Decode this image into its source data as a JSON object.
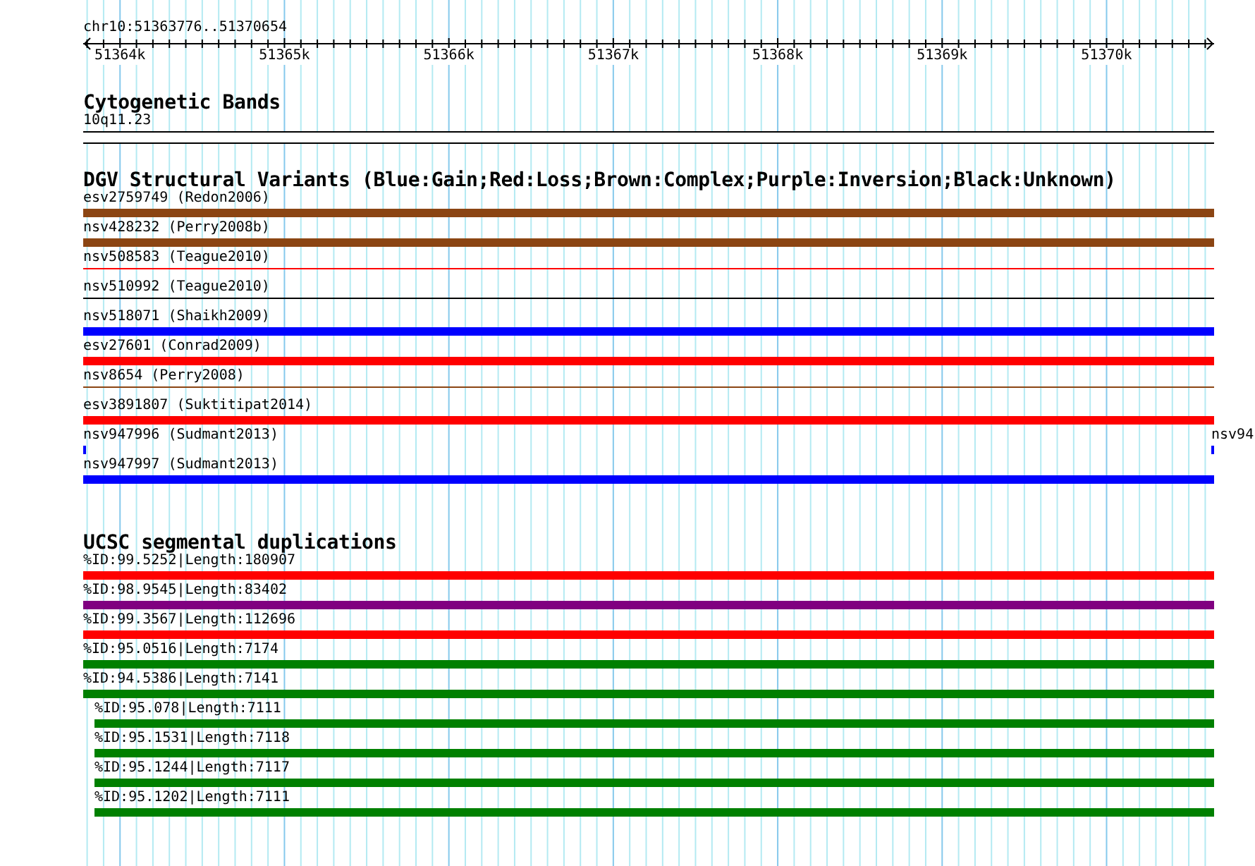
{
  "ruler": {
    "range": "chr10:51363776..51370654",
    "ticks": [
      "51364k",
      "51365k",
      "51366k",
      "51367k",
      "51368k",
      "51369k",
      "51370k"
    ]
  },
  "tracks": [
    {
      "title": "Cytogenetic Bands",
      "kind": "bands",
      "features": [
        {
          "label": "10q11.23"
        }
      ]
    },
    {
      "title": "DGV Structural Variants (Blue:Gain;Red:Loss;Brown:Complex;Purple:Inversion;Black:Unknown)",
      "kind": "features",
      "features": [
        {
          "label": "esv2759749 (Redon2006)",
          "color": "#8b4513",
          "kind": "bar"
        },
        {
          "label": "nsv428232 (Perry2008b)",
          "color": "#8b4513",
          "kind": "bar"
        },
        {
          "label": "nsv508583 (Teague2010)",
          "color": "#ff0000",
          "kind": "line"
        },
        {
          "label": "nsv510992 (Teague2010)",
          "color": "#000000",
          "kind": "line"
        },
        {
          "label": "nsv518071 (Shaikh2009)",
          "color": "#0000ff",
          "kind": "bar"
        },
        {
          "label": "esv27601 (Conrad2009)",
          "color": "#ff0000",
          "kind": "bar"
        },
        {
          "label": "nsv8654 (Perry2008)",
          "color": "#8b4513",
          "kind": "line"
        },
        {
          "label": "esv3891807 (Suktitipat2014)",
          "color": "#ff0000",
          "kind": "bar"
        },
        {
          "label": "nsv947996 (Sudmant2013)",
          "color": "#0000ff",
          "kind": "ticks",
          "end_label": "nsv94"
        },
        {
          "label": "nsv947997 (Sudmant2013)",
          "color": "#0000ff",
          "kind": "bar"
        }
      ]
    },
    {
      "title": "UCSC segmental duplications",
      "kind": "features",
      "features": [
        {
          "label": "%ID:99.5252|Length:180907",
          "color": "#ff0000",
          "kind": "bar",
          "indented": false
        },
        {
          "label": "%ID:98.9545|Length:83402",
          "color": "#800080",
          "kind": "bar",
          "indented": false
        },
        {
          "label": "%ID:99.3567|Length:112696",
          "color": "#ff0000",
          "kind": "bar",
          "indented": false
        },
        {
          "label": "%ID:95.0516|Length:7174",
          "color": "#008000",
          "kind": "bar",
          "indented": false
        },
        {
          "label": "%ID:94.5386|Length:7141",
          "color": "#008000",
          "kind": "bar",
          "indented": false
        },
        {
          "label": "%ID:95.078|Length:7111",
          "color": "#008000",
          "kind": "bar",
          "indented": true
        },
        {
          "label": "%ID:95.1531|Length:7118",
          "color": "#008000",
          "kind": "bar",
          "indented": true
        },
        {
          "label": "%ID:95.1244|Length:7117",
          "color": "#008000",
          "kind": "bar",
          "indented": true
        },
        {
          "label": "%ID:95.1202|Length:7111",
          "color": "#008000",
          "kind": "bar",
          "indented": true
        }
      ]
    }
  ]
}
